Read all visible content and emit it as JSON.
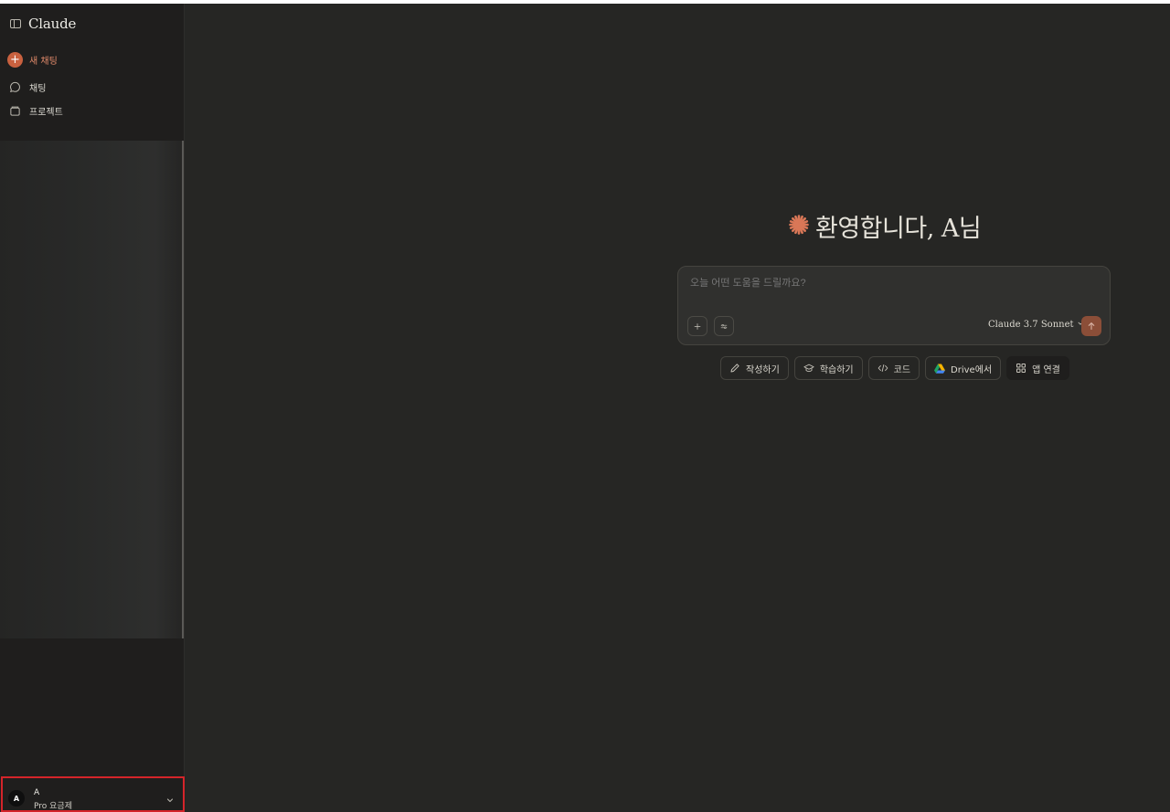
{
  "app": {
    "name": "Claude"
  },
  "sidebar": {
    "new_chat_label": "새 채팅",
    "items": [
      {
        "label": "채팅",
        "icon": "chat-bubble-icon"
      },
      {
        "label": "프로젝트",
        "icon": "folder-icon"
      }
    ]
  },
  "user": {
    "avatar_initial": "A",
    "name": "A",
    "plan": "Pro 요금제"
  },
  "main": {
    "greeting": "환영합니다, A님",
    "composer": {
      "placeholder": "오늘 어떤 도움을 드릴까요?",
      "model": "Claude 3.7 Sonnet"
    },
    "chips": [
      {
        "label": "작성하기",
        "icon": "pencil-icon"
      },
      {
        "label": "학습하기",
        "icon": "graduation-cap-icon"
      },
      {
        "label": "코드",
        "icon": "code-icon"
      },
      {
        "label": "Drive에서",
        "icon": "google-drive-icon"
      },
      {
        "label": "앱 연결",
        "icon": "apps-grid-icon"
      }
    ]
  },
  "colors": {
    "background": "#262624",
    "sidebar": "#1f1e1d",
    "accent": "#c9613f",
    "send_button": "#8b4e38",
    "highlight_border": "#d4242a"
  }
}
